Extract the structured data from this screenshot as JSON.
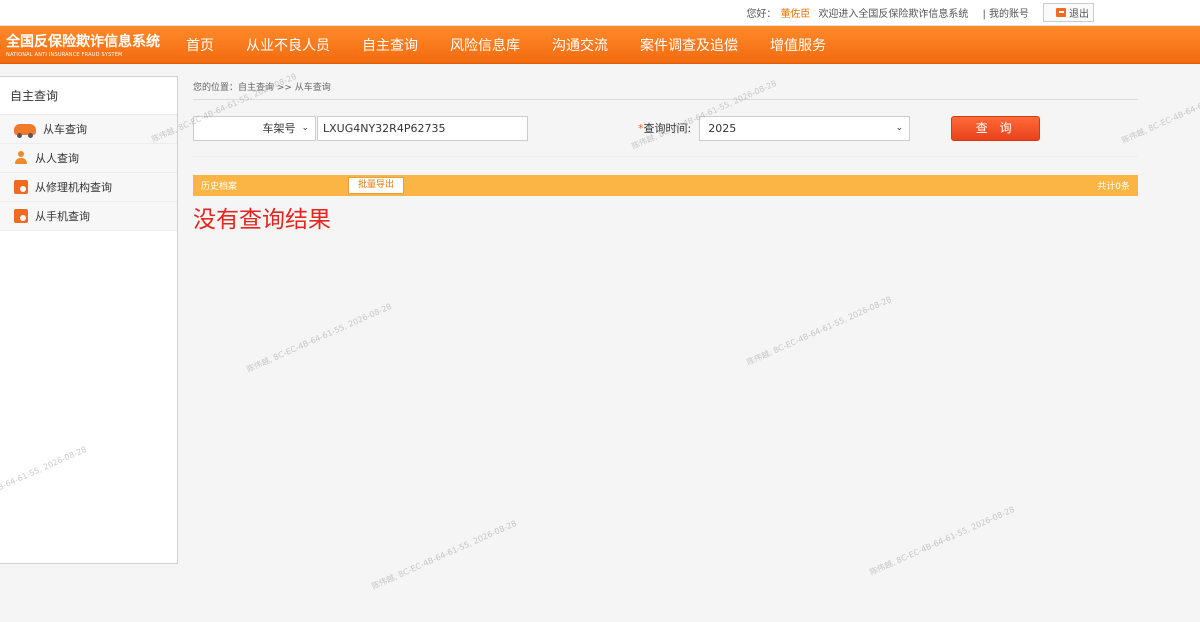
{
  "topbar": {
    "greeting": "您好：",
    "username": "董佐臣",
    "welcome": "欢迎进入全国反保险欺诈信息系统",
    "my_account": "| 我的账号",
    "logout": "退出"
  },
  "logo": {
    "cn": "全国反保险欺诈信息系统",
    "en": "NATIONAL ANTI INSURANCE FRAUD SYSTEM"
  },
  "nav": {
    "items": [
      "首页",
      "从业不良人员",
      "自主查询",
      "风险信息库",
      "沟通交流",
      "案件调查及追偿",
      "增值服务"
    ]
  },
  "sidebar": {
    "title": "自主查询",
    "items": [
      {
        "label": "从车查询",
        "icon": "car-icon"
      },
      {
        "label": "从人查询",
        "icon": "person-icon"
      },
      {
        "label": "从修理机构查询",
        "icon": "document-icon"
      },
      {
        "label": "从手机查询",
        "icon": "document-icon"
      }
    ]
  },
  "breadcrumb": "您的位置：自主查询 >> 从车查询",
  "search": {
    "type_select": "车架号",
    "vin_value": "LXUG4NY32R4P62735",
    "time_label": "查询时间:",
    "time_star": "*",
    "time_select": "2025",
    "query_button": "查 询"
  },
  "results": {
    "history_label": "历史档案",
    "export_button": "批量导出",
    "count": "共计0条",
    "no_result": "没有查询结果"
  },
  "watermark": "陈伟越, 8C-EC-4B-64-61-55, 2026-08-28"
}
